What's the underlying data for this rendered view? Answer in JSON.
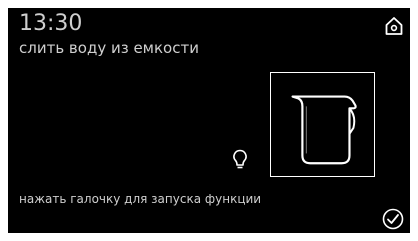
{
  "header": {
    "time": "13:30",
    "subtitle": "слить воду из емкости"
  },
  "icons": {
    "home": "home-icon",
    "water_tank": "water-tank-icon",
    "light_bulb": "light-bulb-icon",
    "confirm": "checkmark-circle-icon"
  },
  "footer": {
    "instruction": "нажать галочку для запуска функции"
  },
  "colors": {
    "background": "#000000",
    "text": "#cfcfcf",
    "icon": "#ffffff"
  }
}
